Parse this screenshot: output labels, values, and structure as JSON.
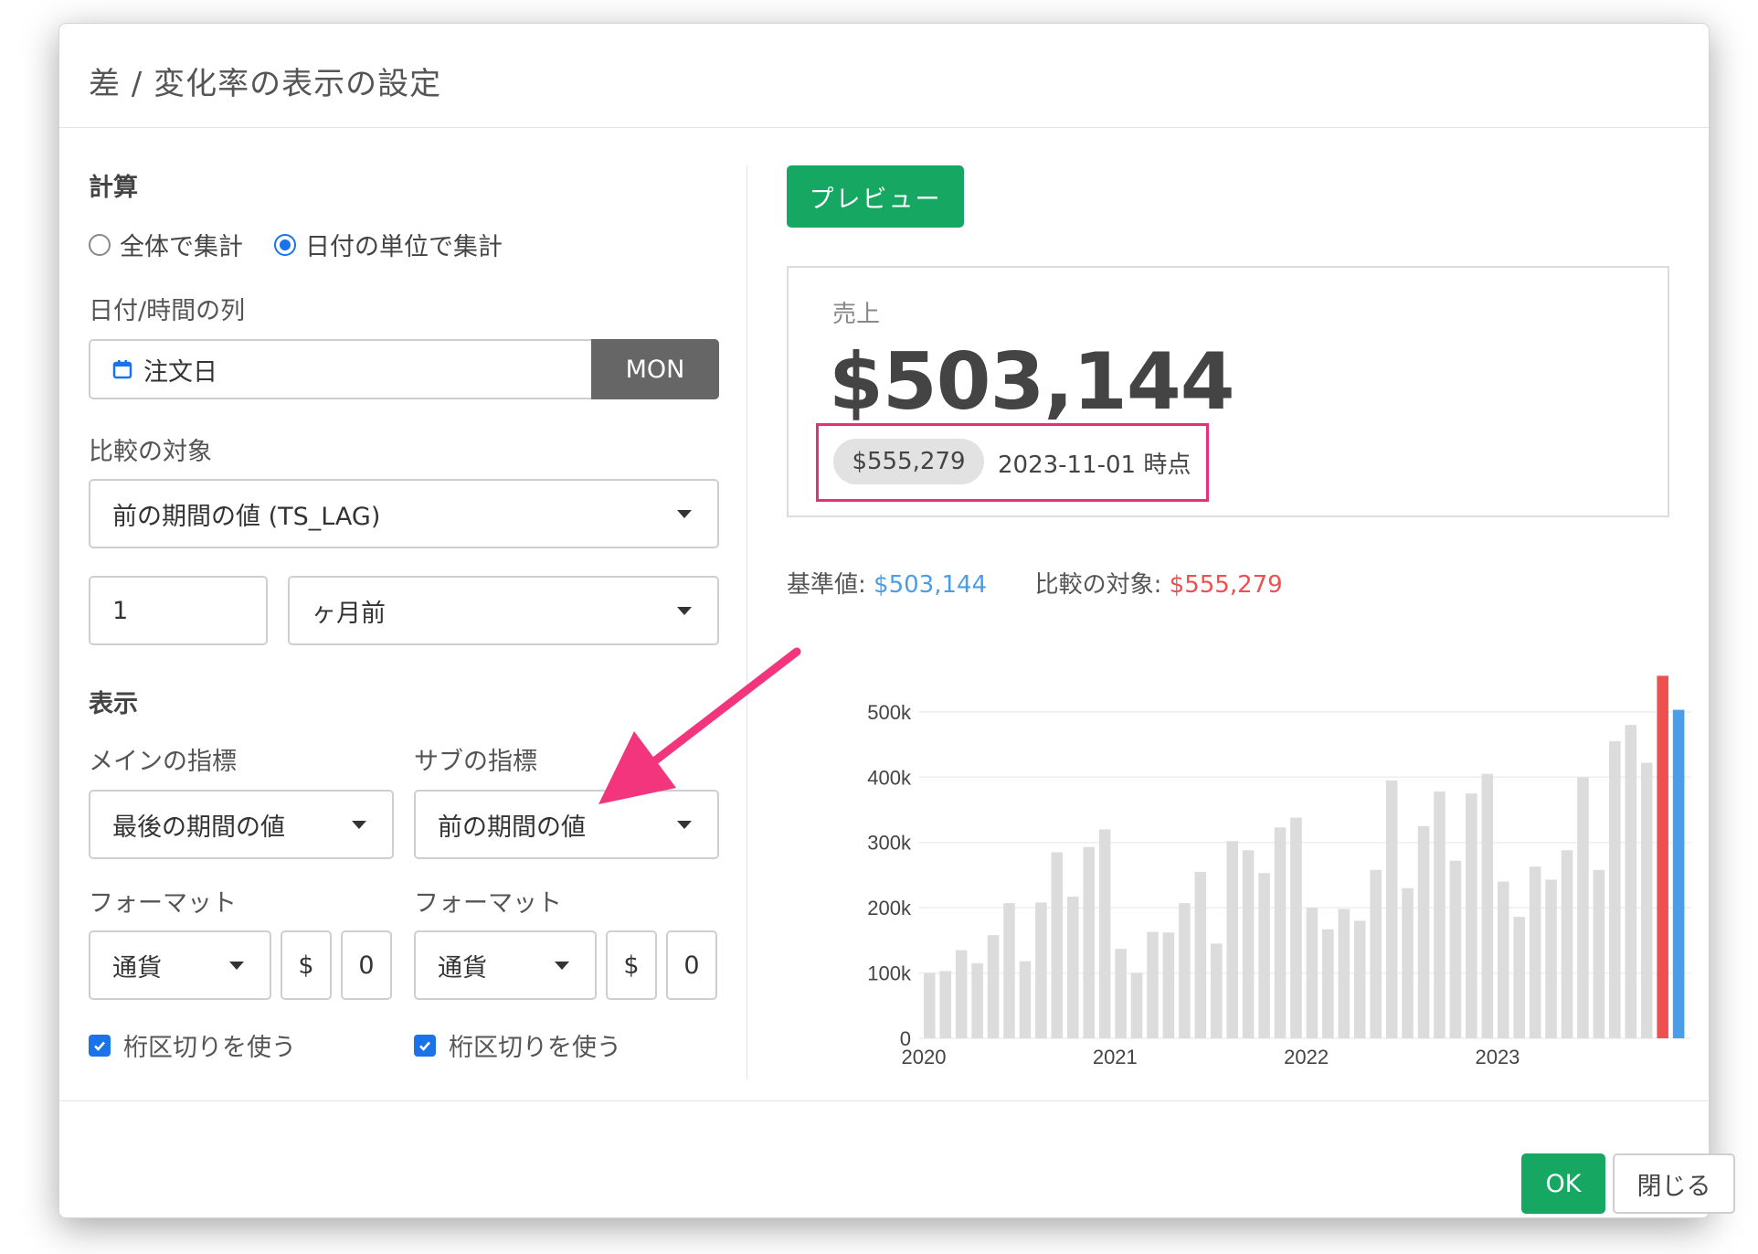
{
  "dialog": {
    "title": "差 / 変化率の表示の設定"
  },
  "calc": {
    "heading": "計算",
    "options": [
      {
        "label": "全体で集計",
        "selected": false
      },
      {
        "label": "日付の単位で集計",
        "selected": true
      }
    ]
  },
  "date_column": {
    "label": "日付/時間の列",
    "value": "注文日",
    "unit": "MON",
    "icon": "calendar-icon"
  },
  "comparison": {
    "label": "比較の対象",
    "value": "前の期間の値 (TS_LAG)",
    "offset": "1",
    "offset_unit": "ヶ月前"
  },
  "display": {
    "heading": "表示",
    "main_metric": {
      "label": "メインの指標",
      "value": "最後の期間の値"
    },
    "sub_metric": {
      "label": "サブの指標",
      "value": "前の期間の値"
    },
    "main_format": {
      "label": "フォーマット",
      "type": "通貨",
      "symbol": "$",
      "digits": "0",
      "separator_label": "桁区切りを使う",
      "separator_checked": true
    },
    "sub_format": {
      "label": "フォーマット",
      "type": "通貨",
      "symbol": "$",
      "digits": "0",
      "separator_label": "桁区切りを使う",
      "separator_checked": true
    }
  },
  "preview": {
    "button_label": "プレビュー",
    "card_label": "売上",
    "main_value": "$503,144",
    "compare_value": "$555,279",
    "compare_date": "2023-11-01 時点",
    "base_label": "基準値:",
    "base_value": "$503,144",
    "target_label": "比較の対象:",
    "target_value": "$555,279"
  },
  "colors": {
    "accent_green": "#16a863",
    "highlight_pink": "#e8307a",
    "base_blue": "#4a9de8",
    "target_red": "#ee5050",
    "bar_gray": "#dcdcdc"
  },
  "chart_data": {
    "type": "bar",
    "x_ticks": [
      "2020",
      "2021",
      "2022",
      "2023"
    ],
    "y_ticks": [
      "0",
      "100k",
      "200k",
      "300k",
      "400k",
      "500k"
    ],
    "ylim": [
      0,
      560000
    ],
    "values": [
      100000,
      103000,
      135000,
      115000,
      158000,
      207000,
      118000,
      208000,
      285000,
      217000,
      293000,
      320000,
      137000,
      100000,
      163000,
      162000,
      207000,
      255000,
      145000,
      302000,
      288000,
      253000,
      323000,
      338000,
      200000,
      167000,
      198000,
      180000,
      258000,
      395000,
      230000,
      325000,
      378000,
      272000,
      375000,
      405000,
      240000,
      186000,
      263000,
      243000,
      288000,
      400000,
      258000,
      455000,
      480000,
      422000,
      555279,
      503144
    ],
    "highlight": {
      "compare_index": 46,
      "base_index": 47
    }
  },
  "footer": {
    "ok_label": "OK",
    "close_label": "閉じる"
  }
}
